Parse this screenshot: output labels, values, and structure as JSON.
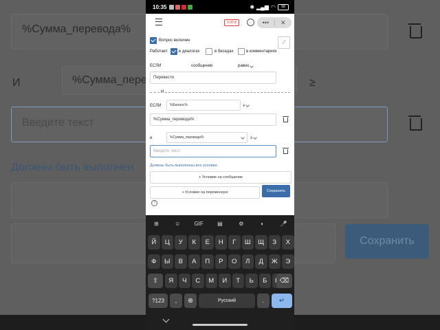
{
  "background": {
    "field1": "%Сумма_перевода%",
    "and_label": "И",
    "field2": "%Сумма_перевода%",
    "op": "≥",
    "input_placeholder": "Введите текст",
    "conditions_text": "Должны быть выполнен",
    "save_label": "Сохранить"
  },
  "status": {
    "time": "10:35",
    "battery": "58"
  },
  "topbar": {
    "balance": "0.00 ₽",
    "more": "•••",
    "close": "✕"
  },
  "question": {
    "enabled_label": "Вопрос включен"
  },
  "works": {
    "label": "Работает",
    "options": [
      {
        "label": "в диалогах",
        "checked": true
      },
      {
        "label": "в беседах",
        "checked": false
      },
      {
        "label": "в комментариях",
        "checked": false
      }
    ]
  },
  "if1": {
    "label": "ЕСЛИ",
    "source": "сообщение",
    "op": "равно",
    "value": "Перевести"
  },
  "and_divider": "И",
  "if2": {
    "label": "ЕСЛИ",
    "variable": "%Баланс%",
    "op": "≥",
    "value": "%Сумма_перевода%"
  },
  "and2": {
    "label": "и",
    "variable": "%Сумма_перевода%",
    "op": "≥",
    "placeholder": "Введите текст"
  },
  "must_all": "Должны быть выполнены все условия",
  "add_message_condition": "+ Условие на сообщение",
  "add_variable_condition": "+ Условие на переменную",
  "save": "Сохранить",
  "keyboard": {
    "tools": [
      "⊞",
      "☺",
      "GIF",
      "▤",
      "⚙",
      "◐",
      "🎤"
    ],
    "row1": [
      "Й",
      "Ц",
      "У",
      "К",
      "Е",
      "Н",
      "Г",
      "Ш",
      "Щ",
      "З",
      "Х"
    ],
    "row2": [
      "Ф",
      "Ы",
      "В",
      "А",
      "П",
      "Р",
      "О",
      "Л",
      "Д",
      "Ж",
      "Э"
    ],
    "row3": [
      "Я",
      "Ч",
      "С",
      "М",
      "И",
      "Т",
      "Ь",
      "Б",
      "Ю"
    ],
    "sym": "?123",
    "comma": ",",
    "space": "Русский",
    "period": "."
  },
  "colors": {
    "accent": "#3b6ea8",
    "red": "#e53935"
  }
}
